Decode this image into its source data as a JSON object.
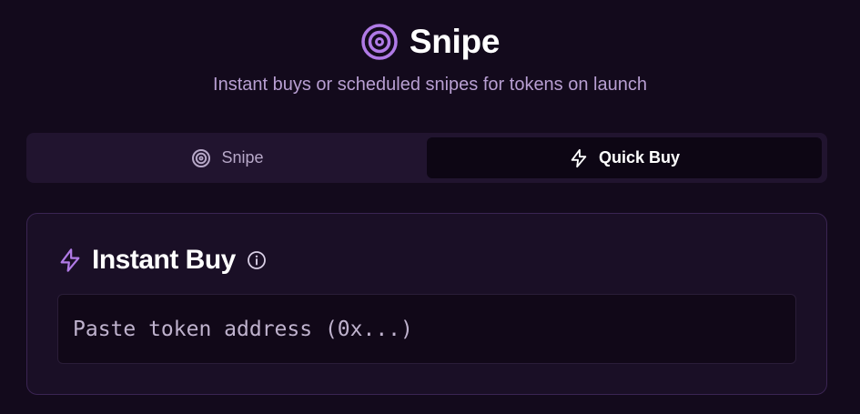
{
  "header": {
    "title": "Snipe",
    "title_icon": "target-icon",
    "subtitle": "Instant buys or scheduled snipes for tokens on launch"
  },
  "tabs": [
    {
      "label": "Snipe",
      "icon": "target-icon",
      "active": false
    },
    {
      "label": "Quick Buy",
      "icon": "lightning-icon",
      "active": true
    }
  ],
  "card": {
    "title": "Instant Buy",
    "title_icon": "lightning-icon",
    "info_icon": "info-icon",
    "address_input": {
      "value": "",
      "placeholder": "Paste token address (0x...)"
    }
  },
  "colors": {
    "background": "#130a1c",
    "accent": "#b07ae6",
    "subtitle": "#b89fd2",
    "tab_bar": "#21142f",
    "active_tab": "#0d0614",
    "card_border": "#3a2552"
  }
}
